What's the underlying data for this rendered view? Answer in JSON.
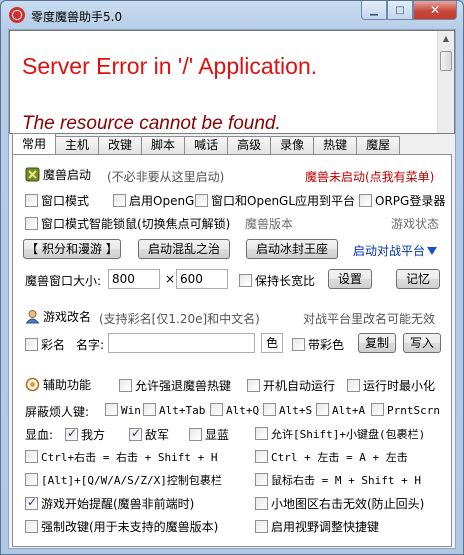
{
  "window": {
    "title": "零度魔兽助手5.0"
  },
  "browser": {
    "error_title": "Server Error in '/' Application.",
    "error_detail": "The resource cannot be found."
  },
  "tabs": [
    "常用",
    "主机",
    "改键",
    "脚本",
    "喊话",
    "高级",
    "录像",
    "热键",
    "魔屋"
  ],
  "launch": {
    "label": "魔兽启动",
    "hint": "(不必非要从这里启动)",
    "status": "魔兽未启动(点我有菜单)",
    "opt_window_mode": "窗口模式",
    "opt_opengl": "启用OpenGL",
    "opt_window_opengl_platform": "窗口和OpenGL应用到平台",
    "opt_orpg": "ORPG登录器",
    "opt_smart_lock": "窗口模式智能锁鼠(切换焦点可解锁)",
    "version_label": "魔兽版本",
    "game_state_label": "游戏状态",
    "btn_points": "【 积分和漫游 】",
    "btn_hunluan": "启动混乱之治",
    "btn_frozen": "启动冰封王座",
    "btn_platform": "启动对战平台",
    "size_label": "魔兽窗口大小:",
    "width": "800",
    "height": "600",
    "times": "×",
    "opt_keep_ratio": "保持长宽比",
    "btn_settings": "设置",
    "btn_remember": "记忆"
  },
  "rename": {
    "label": "游戏改名",
    "hint": "(支持彩名[仅1.20e]和中文名)",
    "note": "对战平台里改名可能无效",
    "opt_color_name": "彩名",
    "name_label": "名字:",
    "name_value": "",
    "color_btn": "色",
    "opt_with_color": "带彩色",
    "btn_copy": "复制",
    "btn_write": "写入"
  },
  "assist": {
    "label": "辅助功能",
    "opt_force_exit_hotkey": "允许强退魔兽热键",
    "opt_autostart": "开机自动运行",
    "opt_minimize": "运行时最小化",
    "shield_label": "屏蔽烦人键:",
    "shield_keys": [
      "Win",
      "Alt+Tab",
      "Alt+Q",
      "Alt+S",
      "Alt+A",
      "PrntScrn"
    ],
    "blood_label": "显血:",
    "blood_self": "我方",
    "blood_enemy": "敌军",
    "blood_blue": "显蓝",
    "opt_shift_keypad": "允许[Shift]+小键盘(包裹栏)",
    "opt_ctrl_right": "Ctrl+右击 = 右击 + Shift + H",
    "opt_ctrl_left": "Ctrl + 左击 = A + 左击",
    "opt_alt_qwas": "[Alt]+[Q/W/A/S/Z/X]控制包裹栏",
    "opt_mouse_right": "鼠标右击 = M + Shift + H",
    "opt_game_start_remind": "游戏开始提醒(魔兽非前端时)",
    "opt_minimap_right": "小地图区右击无效(防止回头)",
    "opt_force_keymap": "强制改键(用于未支持的魔兽版本)",
    "opt_view_adjust": "启用视野调整快捷键"
  },
  "colors": {
    "accent_red": "#e01010",
    "status_red": "#c00000",
    "link_blue": "#0033aa"
  }
}
